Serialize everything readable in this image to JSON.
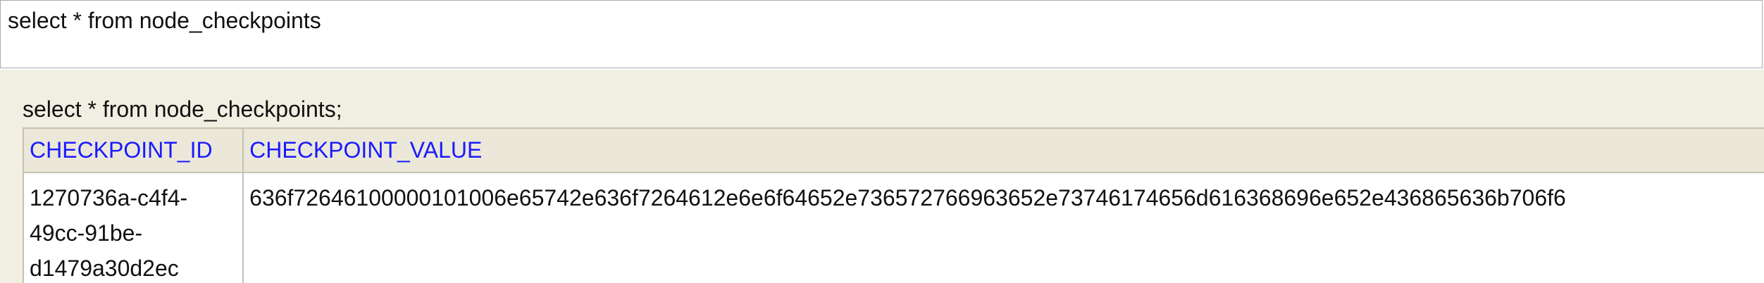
{
  "editor": {
    "query": "select * from node_checkpoints"
  },
  "results": {
    "statement": "select * from node_checkpoints;",
    "columns": [
      "CHECKPOINT_ID",
      "CHECKPOINT_VALUE"
    ],
    "rows": [
      {
        "checkpoint_id": "1270736a-c4f4-49cc-91be-d1479a30d2ec",
        "checkpoint_id_lines": [
          "1270736a-c4f4-",
          "49cc-91be-",
          "d1479a30d2ec"
        ],
        "checkpoint_value": "636f7264610000010100 6e65742e636f7264612e6e6f64652e736572766963652e73746174656d616368696e652e436865636b706f6"
      }
    ]
  },
  "colors": {
    "panel_background": "#f1efe2",
    "header_background": "#ebe8da",
    "header_text": "#1a1aff",
    "cell_border": "#c6c2b2"
  }
}
